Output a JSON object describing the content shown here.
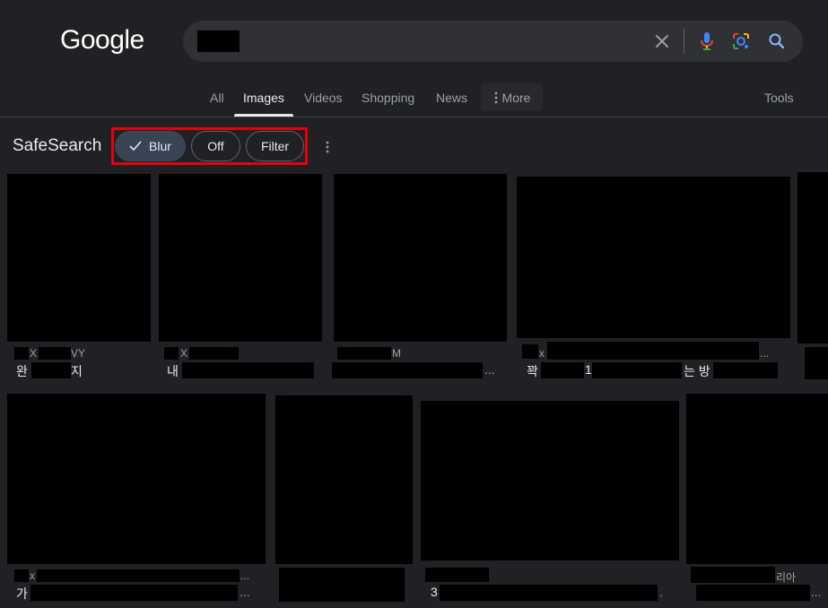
{
  "header": {
    "logo_text": "Google",
    "search": {
      "query": ""
    }
  },
  "icons": {
    "clear": "close-icon",
    "voice": "microphone-icon",
    "lens": "lens-icon",
    "search": "search-icon",
    "more": "more-vertical-icon",
    "check": "check-icon"
  },
  "tabs": {
    "all": "All",
    "images": "Images",
    "videos": "Videos",
    "shopping": "Shopping",
    "news": "News",
    "more": "More",
    "tools": "Tools",
    "active": "Images"
  },
  "safesearch": {
    "label": "SafeSearch",
    "options": [
      {
        "label": "Blur",
        "selected": true
      },
      {
        "label": "Off",
        "selected": false
      },
      {
        "label": "Filter",
        "selected": false
      }
    ]
  },
  "results": {
    "row1": [
      {
        "source_fragments": [
          "X",
          "VY"
        ],
        "title_fragments": [
          "완",
          "지"
        ]
      },
      {
        "source_fragments": [
          "X"
        ],
        "title_fragments": [
          "내"
        ]
      },
      {
        "source_fragments": [
          "M"
        ],
        "title_fragments": [
          "..."
        ]
      },
      {
        "source_fragments": [
          "x",
          "..."
        ],
        "title_fragments": [
          "꽉",
          "1",
          "는 방"
        ]
      },
      {
        "source_fragments": [],
        "title_fragments": []
      }
    ],
    "row2": [
      {
        "source_fragments": [
          "x",
          "..."
        ],
        "title_fragments": [
          "가",
          "..."
        ]
      },
      {
        "source_fragments": [],
        "title_fragments": []
      },
      {
        "source_fragments": [],
        "title_fragments": [
          "3",
          "."
        ]
      },
      {
        "source_fragments": [
          "리아"
        ],
        "title_fragments": [
          "..."
        ]
      }
    ]
  },
  "colors": {
    "background": "#202124",
    "search_box": "#303134",
    "selected_chip": "#394457",
    "highlight": "#e3000f",
    "blue": "#4285f4",
    "red": "#ea4335",
    "yellow": "#fbbc05",
    "green": "#34a853"
  }
}
